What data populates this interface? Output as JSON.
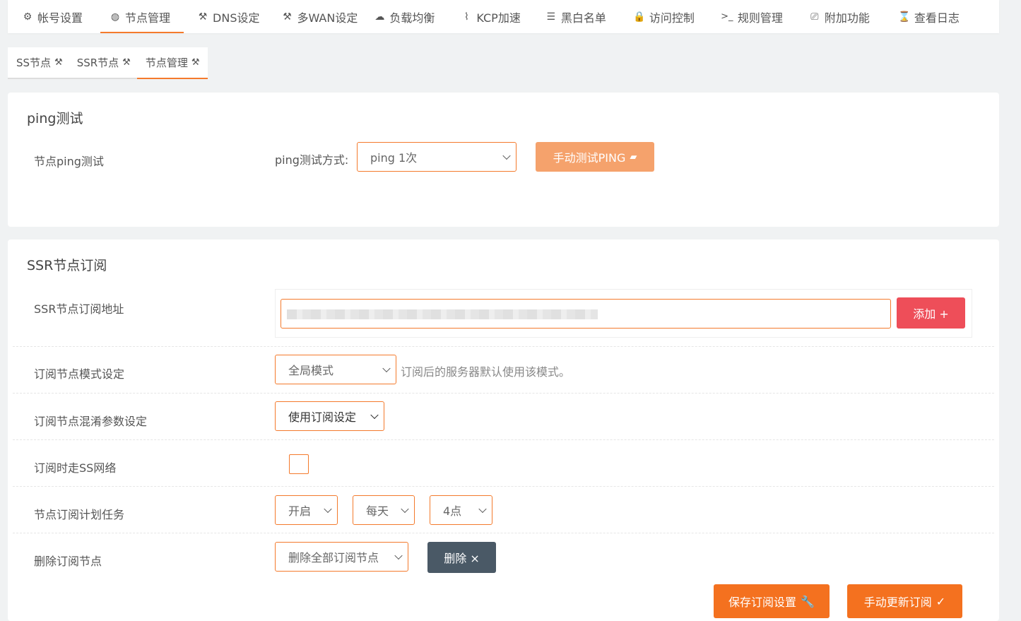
{
  "topnav": [
    {
      "icon": "gear-icon",
      "glyph": "⚙",
      "label": "帐号设置"
    },
    {
      "icon": "globe-icon",
      "glyph": "🌍",
      "label": "节点管理",
      "active": true
    },
    {
      "icon": "tools-icon",
      "glyph": "⚒",
      "label": "DNS设定"
    },
    {
      "icon": "hammer-icon",
      "glyph": "🔨",
      "label": "多WAN设定"
    },
    {
      "icon": "cloud-icon",
      "glyph": "☁",
      "label": "负载均衡"
    },
    {
      "icon": "chart-icon",
      "glyph": "📈",
      "label": "KCP加速"
    },
    {
      "icon": "list-icon",
      "glyph": "☰",
      "label": "黑白名单"
    },
    {
      "icon": "lock-icon",
      "glyph": "🔒",
      "label": "访问控制"
    },
    {
      "icon": "terminal-icon",
      "glyph": ">_",
      "label": "规则管理"
    },
    {
      "icon": "settings-monitor-icon",
      "glyph": "🖥",
      "label": "附加功能"
    },
    {
      "icon": "hourglass-icon",
      "glyph": "⌛",
      "label": "查看日志"
    }
  ],
  "subtabs": [
    {
      "label": "SS节点"
    },
    {
      "label": "SSR节点"
    },
    {
      "label": "节点管理",
      "active": true
    }
  ],
  "ping": {
    "title": "ping测试",
    "row_label": "节点ping测试",
    "method_label": "ping测试方式:",
    "method_value": "ping 1次",
    "test_button": "手动测试PING"
  },
  "ssr": {
    "title": "SSR节点订阅",
    "url_label": "SSR节点订阅地址",
    "add_button": "添加 +",
    "mode_label": "订阅节点模式设定",
    "mode_value": "全局模式",
    "mode_hint": "订阅后的服务器默认使用该模式。",
    "obfs_label": "订阅节点混淆参数设定",
    "obfs_value": "使用订阅设定",
    "via_ss_label": "订阅时走SS网络",
    "schedule_label": "节点订阅计划任务",
    "schedule_enable": "开启",
    "schedule_freq": "每天",
    "schedule_hour": "4点",
    "delete_label": "删除订阅节点",
    "delete_value": "删除全部订阅节点",
    "delete_button": "删除 ×",
    "save_button": "保存订阅设置",
    "update_button": "手动更新订阅"
  },
  "colors": {
    "accent": "#f47a2c",
    "danger": "#ee4e59",
    "dark": "#4a5966"
  }
}
